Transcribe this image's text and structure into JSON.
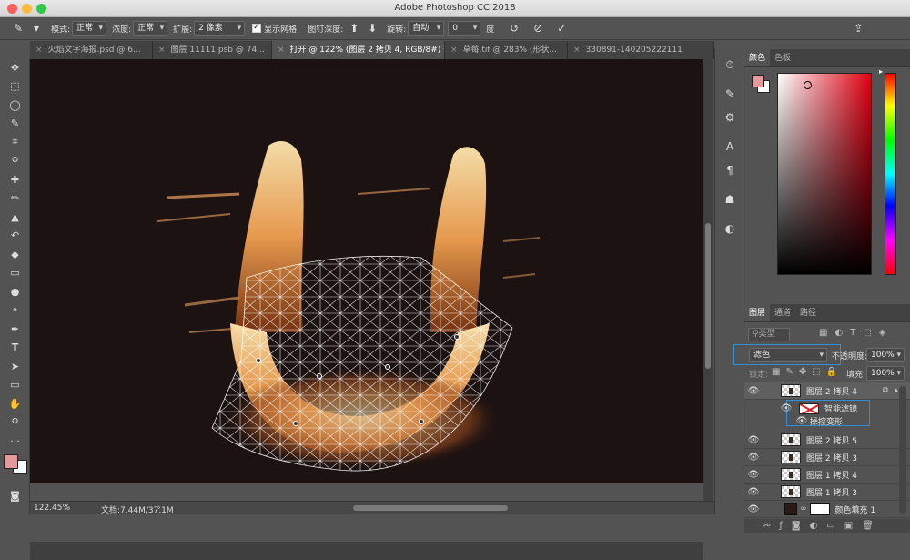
{
  "window": {
    "title": "Adobe Photoshop CC 2018"
  },
  "options": {
    "mode_label": "模式:",
    "mode_value": "正常",
    "density_label": "浓度:",
    "density_value": "正常",
    "expand_label": "扩展:",
    "expand_value": "2 像素",
    "show_mesh_label": "显示网格",
    "pin_depth_label": "图钉深度:",
    "rotate_label": "旋转:",
    "rotate_value": "自动",
    "angle_value": "0",
    "angle_unit": "度"
  },
  "tabs": [
    {
      "label": "火焰文字海报.psd @ 6..."
    },
    {
      "label": "图层 11111.psb @ 74..."
    },
    {
      "label": "打开 @ 122% (图层 2 拷贝 4, RGB/8#) *"
    },
    {
      "label": "草莓.tif @ 283% (形状..."
    },
    {
      "label": "330891-140205222111"
    }
  ],
  "status": {
    "zoom": "122.45%",
    "doc": "文档:7.44M/37.1M"
  },
  "color_panel": {
    "tabs": [
      "颜色",
      "色板"
    ],
    "fg_color": "#e49a9a",
    "bg_color": "#ffffff"
  },
  "layers_panel": {
    "tabs": [
      "图层",
      "通道",
      "路径"
    ],
    "filter_placeholder": "类型",
    "blend_mode": "滤色",
    "opacity_label": "不透明度:",
    "opacity_value": "100%",
    "lock_label": "锁定:",
    "fill_label": "填充:",
    "fill_value": "100%",
    "layers": [
      {
        "name": "图层 2 拷贝 4"
      },
      {
        "name": "智能滤镜"
      },
      {
        "name": "操控变形"
      },
      {
        "name": "图层 2 拷贝 5"
      },
      {
        "name": "图层 2 拷贝 3"
      },
      {
        "name": "图层 1 拷贝 4"
      },
      {
        "name": "图层 1 拷贝 3"
      },
      {
        "name": "颜色填充 1"
      }
    ]
  },
  "colors": {
    "highlight_box": "#2f8fd8",
    "canvas_bg": "#1c1212"
  }
}
